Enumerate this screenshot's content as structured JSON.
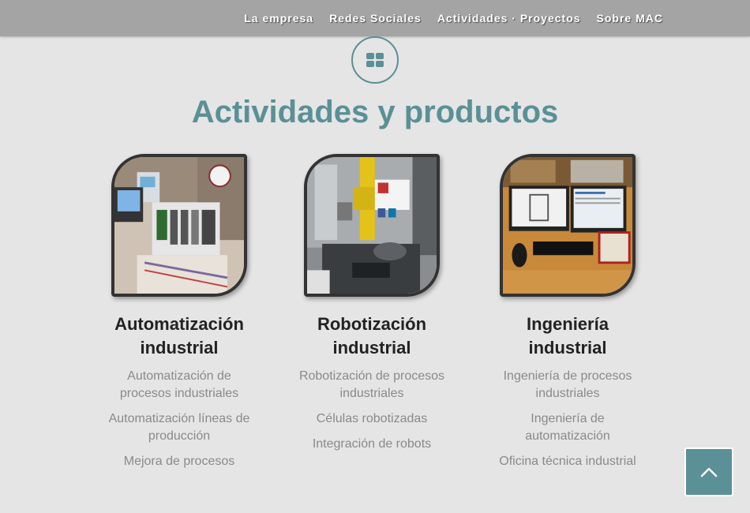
{
  "nav": {
    "items": [
      "La empresa",
      "Redes Sociales",
      "Actividades · Proyectos",
      "Sobre MAC"
    ]
  },
  "section": {
    "icon": "grid-icon",
    "title": "Actividades y productos"
  },
  "columns": [
    {
      "title_line1": "Automatización",
      "title_line2": "industrial",
      "items": [
        "Automatización de procesos industriales",
        "Automatización líneas de producción",
        "Mejora de procesos"
      ]
    },
    {
      "title_line1": "Robotización",
      "title_line2": "industrial",
      "items": [
        "Robotización de procesos industriales",
        "Células robotizadas",
        "Integración de robots"
      ]
    },
    {
      "title_line1": "Ingeniería",
      "title_line2": "industrial",
      "items": [
        "Ingeniería de procesos industriales",
        "Ingeniería de automatización",
        "Oficina técnica industrial"
      ]
    }
  ],
  "back_to_top": {
    "icon": "chevron-up-icon"
  },
  "colors": {
    "accent": "#5a9096",
    "nav_bg": "#a4a4a4",
    "page_bg": "#e5e5e5"
  }
}
